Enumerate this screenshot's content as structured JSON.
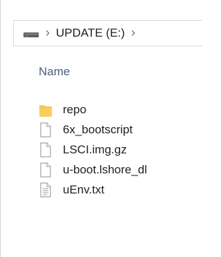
{
  "address_bar": {
    "drive_icon": "drive-icon",
    "separator_glyph": "›",
    "location": "UPDATE (E:)"
  },
  "column_header": {
    "name": "Name"
  },
  "files": [
    {
      "name": "repo",
      "type": "folder",
      "icon": "folder-icon"
    },
    {
      "name": "6x_bootscript",
      "type": "file",
      "icon": "file-icon"
    },
    {
      "name": "LSCI.img.gz",
      "type": "file",
      "icon": "file-icon"
    },
    {
      "name": "u-boot.lshore_dl",
      "type": "file",
      "icon": "file-icon"
    },
    {
      "name": "uEnv.txt",
      "type": "text",
      "icon": "text-file-icon"
    }
  ],
  "colors": {
    "folder": "#f7d46a",
    "header_text": "#4c607a",
    "text": "#1f1f1f"
  }
}
